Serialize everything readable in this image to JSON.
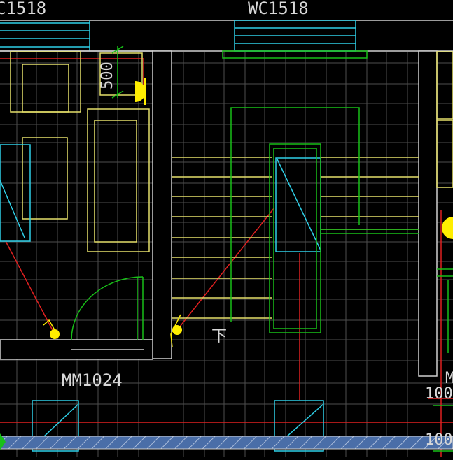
{
  "drawing": {
    "background": "#000000",
    "layer_colors": {
      "walls": "#d0d0d0",
      "grid": "#5a5a5a",
      "windows": "#2fd0e8",
      "furniture": "#e6e06a",
      "doors": "#18c018",
      "electrical": "#e02020",
      "fixtures": "#ffee00",
      "hatch": "#4a6ea8"
    },
    "labels": {
      "window_left": "C1518",
      "window_center": "WC1518",
      "door_label": "MM1024",
      "dimension_vertical": "500",
      "stair_direction": "下",
      "dimension_right_1": "100",
      "dimension_right_2": "100",
      "edge_fragment": "M"
    },
    "icons": [
      "light-fixture-icon",
      "switch-icon",
      "door-swing-icon",
      "stair-arrow-icon"
    ]
  }
}
